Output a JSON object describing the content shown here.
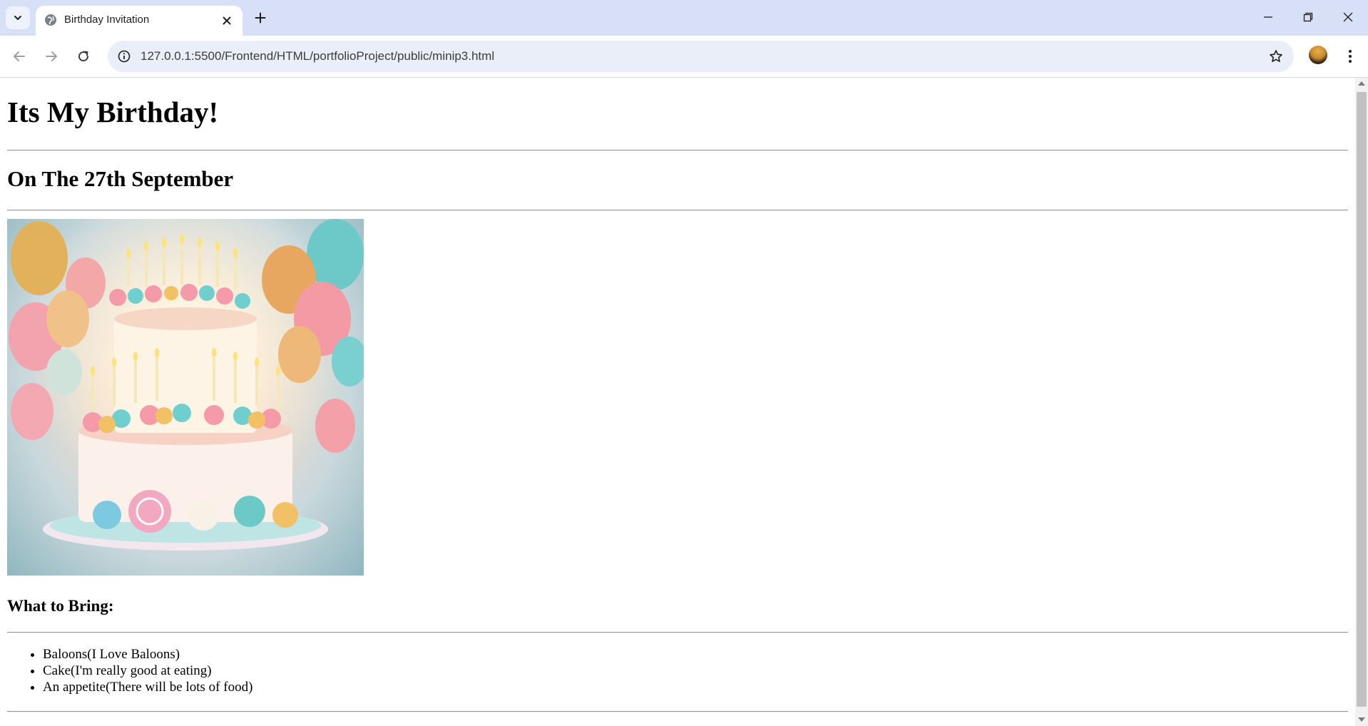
{
  "browser": {
    "tab_title": "Birthday Invitation",
    "url": "127.0.0.1:5500/Frontend/HTML/portfolioProject/public/minip3.html",
    "icons": {
      "tab_search": "chevron-down-icon",
      "favicon": "globe-icon",
      "close": "close-icon",
      "new_tab": "plus-icon",
      "minimize": "minimize-icon",
      "restore": "restore-icon",
      "window_close": "close-icon",
      "back": "back-arrow-icon",
      "forward": "forward-arrow-icon",
      "reload": "reload-icon",
      "site_info": "info-icon",
      "bookmark": "star-icon",
      "menu": "kebab-menu-icon"
    }
  },
  "page": {
    "heading": "Its My Birthday!",
    "date_heading": "On The 27th September",
    "bring_heading": "What to Bring:",
    "items": [
      "Baloons(I Love Baloons)",
      "Cake(I'm really good at eating)",
      "An appetite(There will be lots of food)"
    ]
  },
  "colors": {
    "tabbar_bg": "#d8e0f8",
    "omnibox_bg": "#eaeef8",
    "page_bg": "#ffffff",
    "text": "#000000"
  }
}
